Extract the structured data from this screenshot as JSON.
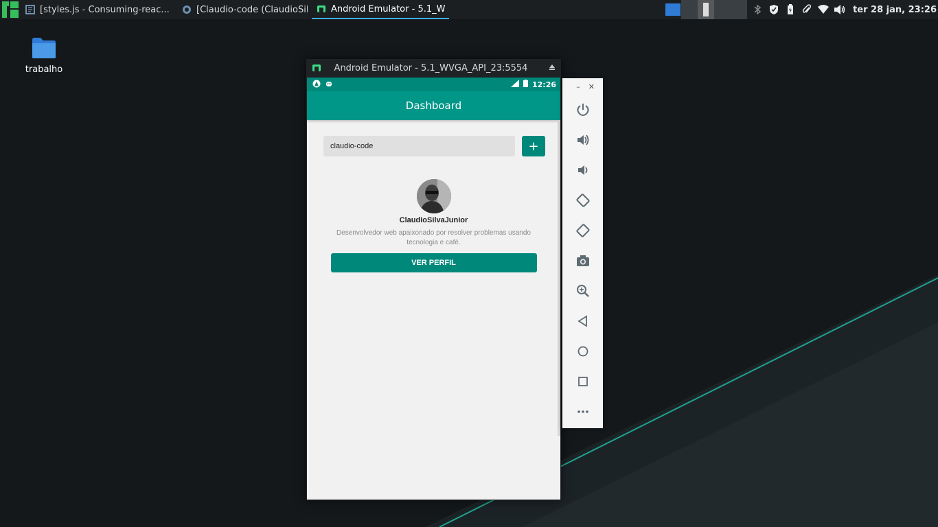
{
  "taskbar": {
    "tasks": [
      {
        "label": "[styles.js - Consuming-reac...",
        "icon": "code-editor-icon"
      },
      {
        "label": "[Claudio-code (ClaudioSilv...",
        "icon": "browser-icon"
      },
      {
        "label": "Android Emulator - 5.1_W...",
        "icon": "android-emulator-icon",
        "active": true
      }
    ],
    "clock": "ter 28 jan, 23:26"
  },
  "desktop": {
    "icons": [
      {
        "label": "trabalho",
        "icon": "folder-icon"
      }
    ]
  },
  "emulator": {
    "title": "Android Emulator - 5.1_WVGA_API_23:5554",
    "status_time": "12:26",
    "app": {
      "appbar_title": "Dashboard",
      "search": {
        "value": "claudio-code",
        "placeholder": ""
      },
      "add_label": "+",
      "profile": {
        "name": "ClaudioSilvaJunior",
        "bio": "Desenvolvedor web apaixonado por resolver problemas usando tecnologia e café.",
        "button": "VER PERFIL"
      }
    },
    "side_toolbar": {
      "minimize": "–",
      "close": "✕",
      "tools": [
        "power-icon",
        "volume-up-icon",
        "volume-down-icon",
        "rotate-left-icon",
        "rotate-right-icon",
        "camera-icon",
        "zoom-icon",
        "back-icon",
        "home-icon",
        "overview-icon",
        "more-icon"
      ]
    }
  },
  "colors": {
    "accent": "#00897b",
    "appbar": "#009688",
    "desktop": "#15191c",
    "wallpaper_line": "#1fa38b"
  }
}
